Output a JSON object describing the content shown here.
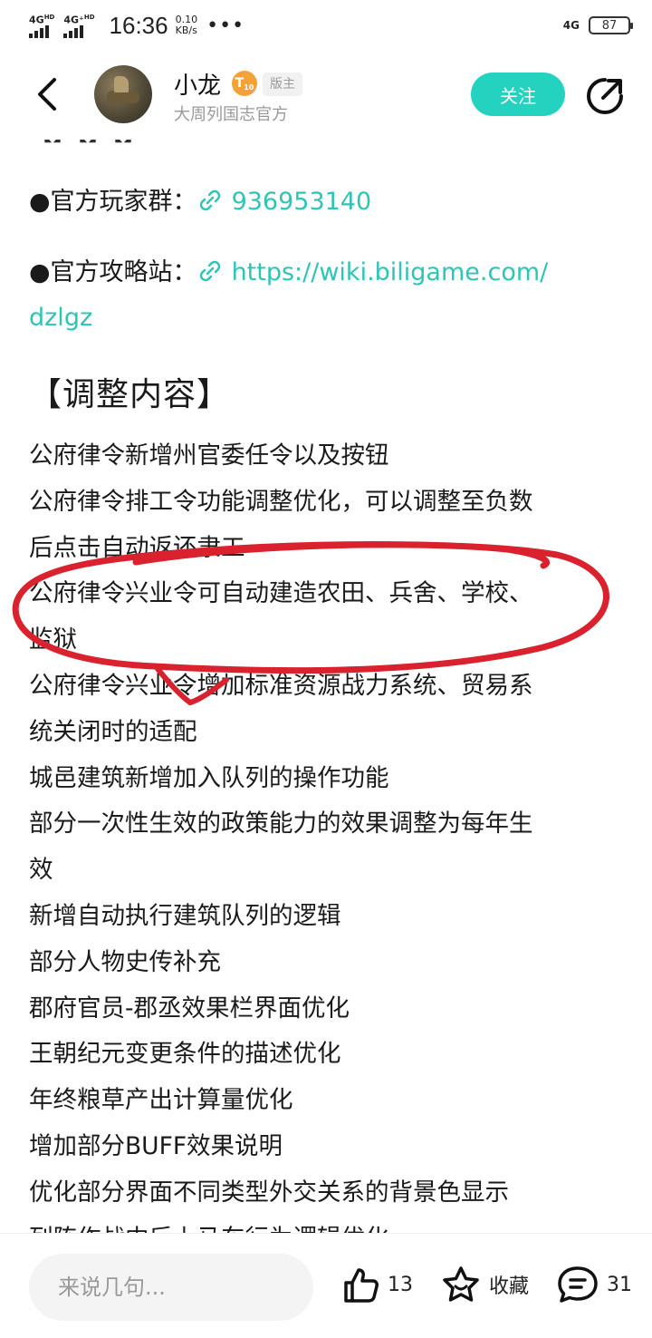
{
  "status_bar": {
    "sim1": "4G",
    "sim1_sup": "HD",
    "sim2": "4G⁺",
    "sim2_sup": "HD",
    "time": "16:36",
    "speed_value": "0.10",
    "speed_unit": "KB/s",
    "more": "•••",
    "network": "4G",
    "battery": "87"
  },
  "header": {
    "username": "小龙",
    "level": "T",
    "level_num": "10",
    "role_badge": "版主",
    "subtitle": "大周列国志官方",
    "follow_label": "关注",
    "accent_color": "#23d3c0"
  },
  "post": {
    "cutoff_text": "【】【】【】",
    "player_group_label": "●官方玩家群：",
    "player_group_link": "936953140",
    "guide_site_label": "●官方攻略站：",
    "guide_site_link_line1": "https://wiki.biligame.com/",
    "guide_site_link_line2": "dzlgz",
    "section_title": "【调整内容】",
    "lines": [
      "公府律令新增州官委任令以及按钮",
      "公府律令排工令功能调整优化，可以调整至负数",
      "后点击自动返还隶工",
      "公府律令兴业令可自动建造农田、兵舍、学校、",
      "监狱",
      "公府律令兴业令增加标准资源战力系统、贸易系",
      "统关闭时的适配",
      "城邑建筑新增加入队列的操作功能",
      "部分一次性生效的政策能力的效果调整为每年生",
      "效",
      "新增自动执行建筑队列的逻辑",
      "部分人物史传补充",
      "郡府官员-郡丞效果栏界面优化",
      "王朝纪元变更条件的描述优化",
      "年终粮草产出计算量优化",
      "增加部分BUFF效果说明",
      "优化部分界面不同类型外交关系的背景色显示",
      "列阵作战中后上马车行为逻辑优化"
    ],
    "link_color": "#2ec4b6",
    "annotation_color": "#d9222e"
  },
  "bottom_bar": {
    "comment_placeholder": "来说几句...",
    "like_count": "13",
    "favorite_label": "收藏",
    "comment_count": "31"
  }
}
